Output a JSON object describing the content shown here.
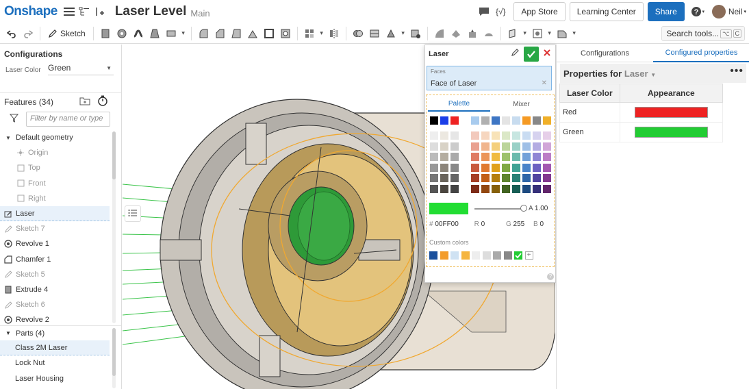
{
  "header": {
    "logo": "Onshape",
    "doc_title": "Laser Level",
    "branch": "Main",
    "app_store": "App Store",
    "learning_center": "Learning Center",
    "share": "Share",
    "user": "Neil",
    "brand_color": "#1c6fbe"
  },
  "toolbar": {
    "sketch_label": "Sketch",
    "search_label": "Search tools...",
    "search_kbd1": "⌥",
    "search_kbd2": "C"
  },
  "left": {
    "config_title": "Configurations",
    "config_label": "Laser Color",
    "config_value": "Green",
    "features_title": "Features (34)",
    "filter_placeholder": "Filter by name or type",
    "tree": [
      {
        "label": "Default geometry",
        "icon": "caret-down-icon",
        "indent": 0,
        "dim": false,
        "sel": false
      },
      {
        "label": "Origin",
        "icon": "origin-icon",
        "indent": 2,
        "dim": true,
        "sel": false
      },
      {
        "label": "Top",
        "icon": "plane-icon",
        "indent": 2,
        "dim": true,
        "sel": false
      },
      {
        "label": "Front",
        "icon": "plane-icon",
        "indent": 2,
        "dim": true,
        "sel": false
      },
      {
        "label": "Right",
        "icon": "plane-icon",
        "indent": 2,
        "dim": true,
        "sel": false
      },
      {
        "label": "Laser",
        "icon": "sketch-icon",
        "indent": 0,
        "dim": false,
        "sel": true
      },
      {
        "label": "Sketch 7",
        "icon": "pencil-icon",
        "indent": 0,
        "dim": true,
        "sel": false
      },
      {
        "label": "Revolve 1",
        "icon": "revolve-icon",
        "indent": 0,
        "dim": false,
        "sel": false
      },
      {
        "label": "Chamfer 1",
        "icon": "chamfer-icon",
        "indent": 0,
        "dim": false,
        "sel": false
      },
      {
        "label": "Sketch 5",
        "icon": "pencil-icon",
        "indent": 0,
        "dim": true,
        "sel": false
      },
      {
        "label": "Extrude 4",
        "icon": "extrude-icon",
        "indent": 0,
        "dim": false,
        "sel": false
      },
      {
        "label": "Sketch 6",
        "icon": "pencil-icon",
        "indent": 0,
        "dim": true,
        "sel": false
      },
      {
        "label": "Revolve 2",
        "icon": "revolve-icon",
        "indent": 0,
        "dim": false,
        "sel": false
      }
    ],
    "parts_title": "Parts (4)",
    "parts": [
      {
        "label": "Class 2M Laser",
        "sel": true
      },
      {
        "label": "Lock Nut",
        "sel": false
      },
      {
        "label": "Laser Housing",
        "sel": false
      }
    ]
  },
  "dialog": {
    "title": "Laser",
    "faces_label": "Faces",
    "faces_value": "Face of Laser",
    "tab_palette": "Palette",
    "tab_mixer": "Mixer",
    "current_color": "#22dd33",
    "alpha_label": "A",
    "alpha_value": "1.00",
    "hex_label": "#",
    "hex_value": "00FF00",
    "r_label": "R",
    "r_value": "0",
    "g_label": "G",
    "g_value": "255",
    "b_label": "B",
    "b_value": "0",
    "custom_colors_label": "Custom colors",
    "custom_colors": [
      "#1a4f9c",
      "#f39c2b",
      "#cfe2f3",
      "#f5b53f",
      "#eeeeee",
      "#dddddd",
      "#aaaaaa",
      "#888888",
      "#22cc33"
    ]
  },
  "right": {
    "tab_configurations": "Configurations",
    "tab_configured": "Configured properties",
    "props_title": "Properties for",
    "props_part": "Laser",
    "col_color": "Laser Color",
    "col_appearance": "Appearance",
    "rows": [
      {
        "name": "Red",
        "color": "#ee2222"
      },
      {
        "name": "Green",
        "color": "#22cc33"
      }
    ]
  }
}
